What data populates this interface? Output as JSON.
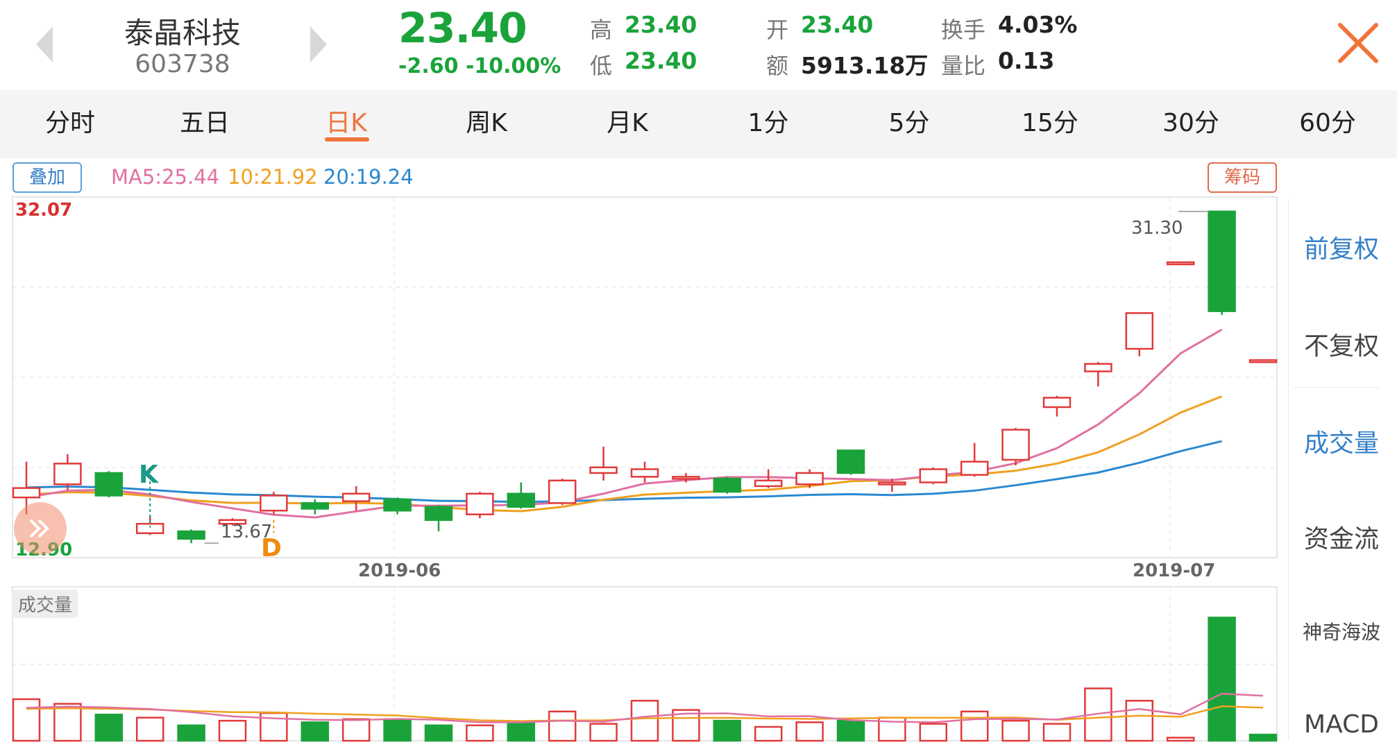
{
  "header": {
    "stock_name": "泰晶科技",
    "stock_code": "603738",
    "price": "23.40",
    "change": "-2.60",
    "change_pct": "-10.00%",
    "stats": [
      {
        "label": "高",
        "value": "23.40",
        "color": "#1aa33a"
      },
      {
        "label": "低",
        "value": "23.40",
        "color": "#1aa33a"
      },
      {
        "label": "开",
        "value": "23.40",
        "color": "#1aa33a"
      },
      {
        "label": "额",
        "value": "5913.18万",
        "color": "#222222"
      },
      {
        "label": "换手",
        "value": "4.03%",
        "color": "#222222"
      },
      {
        "label": "量比",
        "value": "0.13",
        "color": "#222222"
      }
    ]
  },
  "tabs": [
    "分时",
    "五日",
    "日K",
    "周K",
    "月K",
    "1分",
    "5分",
    "15分",
    "30分",
    "60分"
  ],
  "active_tab": "日K",
  "indicators": {
    "overlay_button": "叠加",
    "ma5": "MA5:25.44",
    "ma10": "10:21.92",
    "ma20": "20:19.24",
    "chips_button": "筹码"
  },
  "side_menu": [
    {
      "label": "前复权",
      "selected": true
    },
    {
      "label": "不复权",
      "selected": false
    },
    {
      "label": "成交量",
      "selected": true
    },
    {
      "label": "资金流",
      "selected": false
    },
    {
      "label": "神奇海波",
      "selected": false
    },
    {
      "label": "MACD",
      "selected": false
    }
  ],
  "volume_panel_label": "成交量",
  "colors": {
    "up": "#e03a3a",
    "down": "#1aa33a",
    "ma5": "#e070a0",
    "ma10": "#f0a020",
    "ma20": "#2a88d0",
    "accent": "#f0743a"
  },
  "chart_data": {
    "type": "candlestick",
    "price_axis": {
      "max_label": "32.07",
      "min_label": "12.90",
      "ylim": [
        12.9,
        32.07
      ]
    },
    "x_labels": [
      "2019-06",
      "2019-07"
    ],
    "annotations": {
      "low_label": "13.67",
      "high_label": "31.30",
      "markers": [
        "K",
        "D"
      ]
    },
    "candles": [
      {
        "o": 16.1,
        "c": 16.6,
        "h": 18.0,
        "l": 15.2
      },
      {
        "o": 16.8,
        "c": 17.9,
        "h": 18.4,
        "l": 16.5
      },
      {
        "o": 17.4,
        "c": 16.2,
        "h": 17.5,
        "l": 16.1
      },
      {
        "o": 14.2,
        "c": 14.7,
        "h": 15.1,
        "l": 14.1
      },
      {
        "o": 14.3,
        "c": 13.9,
        "h": 14.4,
        "l": 13.67
      },
      {
        "o": 14.7,
        "c": 14.9,
        "h": 15.0,
        "l": 14.6
      },
      {
        "o": 15.4,
        "c": 16.2,
        "h": 16.4,
        "l": 15.2
      },
      {
        "o": 15.8,
        "c": 15.5,
        "h": 16.0,
        "l": 15.2
      },
      {
        "o": 15.9,
        "c": 16.3,
        "h": 16.7,
        "l": 15.4
      },
      {
        "o": 16.0,
        "c": 15.4,
        "h": 16.1,
        "l": 15.2
      },
      {
        "o": 15.6,
        "c": 14.9,
        "h": 15.7,
        "l": 14.3
      },
      {
        "o": 15.2,
        "c": 16.3,
        "h": 16.4,
        "l": 15.0
      },
      {
        "o": 16.3,
        "c": 15.6,
        "h": 16.9,
        "l": 15.5
      },
      {
        "o": 15.8,
        "c": 17.0,
        "h": 17.1,
        "l": 15.7
      },
      {
        "o": 17.4,
        "c": 17.7,
        "h": 18.8,
        "l": 17.0
      },
      {
        "o": 17.2,
        "c": 17.6,
        "h": 18.0,
        "l": 16.9
      },
      {
        "o": 17.1,
        "c": 17.2,
        "h": 17.4,
        "l": 16.9
      },
      {
        "o": 17.1,
        "c": 16.4,
        "h": 17.2,
        "l": 16.3
      },
      {
        "o": 16.7,
        "c": 17.0,
        "h": 17.6,
        "l": 16.6
      },
      {
        "o": 16.8,
        "c": 17.4,
        "h": 17.6,
        "l": 16.6
      },
      {
        "o": 18.6,
        "c": 17.4,
        "h": 18.6,
        "l": 17.3
      },
      {
        "o": 16.8,
        "c": 16.9,
        "h": 17.1,
        "l": 16.4
      },
      {
        "o": 16.9,
        "c": 17.6,
        "h": 17.7,
        "l": 16.8
      },
      {
        "o": 17.3,
        "c": 18.0,
        "h": 19.0,
        "l": 17.2
      },
      {
        "o": 18.1,
        "c": 19.7,
        "h": 19.8,
        "l": 17.8
      },
      {
        "o": 20.9,
        "c": 21.4,
        "h": 21.5,
        "l": 20.4
      },
      {
        "o": 22.8,
        "c": 23.2,
        "h": 23.3,
        "l": 22.0
      },
      {
        "o": 24.0,
        "c": 25.9,
        "h": 25.9,
        "l": 23.6
      },
      {
        "o": 28.6,
        "c": 28.6,
        "h": 28.6,
        "l": 28.6
      },
      {
        "o": 31.3,
        "c": 26.0,
        "h": 31.3,
        "l": 25.8
      },
      {
        "o": 23.4,
        "c": 23.4,
        "h": 23.4,
        "l": 23.4
      }
    ],
    "volume": [
      0.27,
      0.24,
      0.17,
      0.15,
      0.1,
      0.13,
      0.18,
      0.12,
      0.14,
      0.14,
      0.1,
      0.1,
      0.12,
      0.19,
      0.11,
      0.26,
      0.2,
      0.13,
      0.09,
      0.12,
      0.13,
      0.15,
      0.11,
      0.19,
      0.13,
      0.11,
      0.34,
      0.26,
      0.02,
      0.8,
      0.04
    ]
  }
}
